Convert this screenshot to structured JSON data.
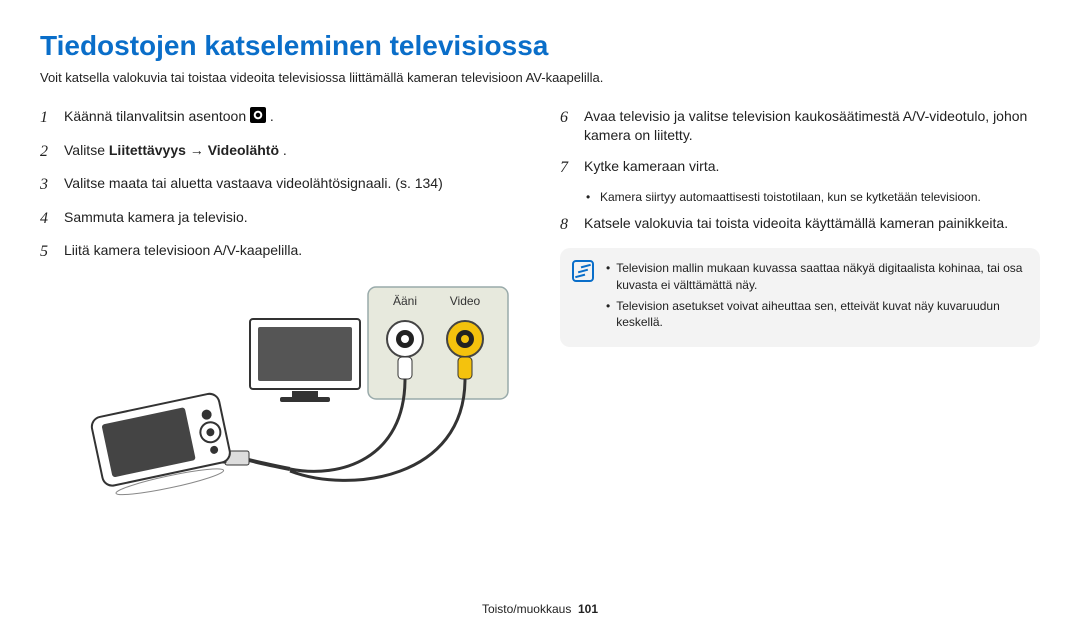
{
  "page_title": "Tiedostojen katseleminen televisiossa",
  "intro": "Voit katsella valokuvia tai toistaa videoita televisiossa liittämällä kameran televisioon AV-kaapelilla.",
  "numbers": {
    "n1": "1",
    "n2": "2",
    "n3": "3",
    "n4": "4",
    "n5": "5",
    "n6": "6",
    "n7": "7",
    "n8": "8"
  },
  "steps": {
    "s1_pre": "Käännä tilanvalitsin asentoon ",
    "s1_post": " .",
    "s2_pre": "Valitse ",
    "s2_bold": "Liitettävyys → Videolähtö",
    "s2_post": ".",
    "s3": "Valitse maata tai aluetta vastaava videolähtösignaali. (s. 134)",
    "s4": "Sammuta kamera ja televisio.",
    "s5": "Liitä kamera televisioon A/V-kaapelilla.",
    "s6": "Avaa televisio ja valitse television kaukosäätimestä A/V-videotulo, johon kamera on liitetty.",
    "s7": "Kytke kameraan virta.",
    "s7_bullet": "Kamera siirtyy automaattisesti toistotilaan, kun se kytketään televisioon.",
    "s8": "Katsele valokuvia tai toista videoita käyttämällä kameran painikkeita."
  },
  "note": {
    "line1": "Television mallin mukaan kuvassa saattaa näkyä digitaalista kohinaa, tai osa kuvasta ei välttämättä näy.",
    "line2": "Television asetukset voivat aiheuttaa sen, etteivät kuvat näy kuvaruudun keskellä."
  },
  "figure_labels": {
    "audio": "Ääni",
    "video": "Video"
  },
  "footer": {
    "section": "Toisto/muokkaus",
    "page": "101"
  },
  "colors": {
    "heading": "#0a6ec9",
    "video_jack": "#f4c20d",
    "panel": "#e7e9dd"
  }
}
